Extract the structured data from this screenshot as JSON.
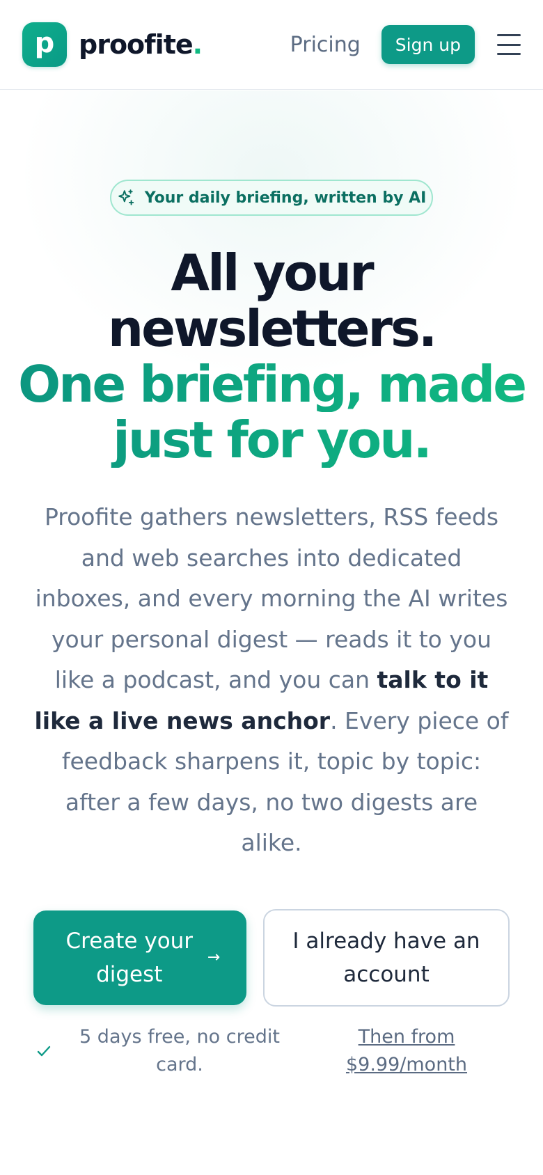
{
  "header": {
    "logo_letter": "p",
    "brand_name": "proofite",
    "brand_dot": ".",
    "nav_pricing": "Pricing",
    "signup_label": "Sign up"
  },
  "hero": {
    "badge": "Your daily briefing, written by AI",
    "headline_line1": "All your",
    "headline_line2": "newsletters.",
    "headline_accent1": "One briefing, made",
    "headline_accent2": "just for you.",
    "description_part1": "Proofite gathers newsletters, RSS feeds and web searches into dedicated inboxes, and every morning the AI writes your personal digest — reads it to you like a podcast, and you can ",
    "description_bold": "talk to it like a live news anchor",
    "description_part2": ". Every piece of feedback sharpens it, topic by topic: after a few days, no two digests are alike.",
    "cta_primary": "Create your digest",
    "cta_secondary": "I already have an account",
    "trial_note": "5 days free, no credit card.",
    "price_link": "Then from $9.99/month"
  },
  "colors": {
    "brand": "#0d9a87",
    "accent": "#10b981",
    "text_dark": "#0f172a",
    "text_muted": "#64748b"
  },
  "icons": {
    "menu": "hamburger-menu-icon",
    "badge": "sparkles-icon",
    "cta_arrow": "arrow-right-icon",
    "trial": "check-icon"
  }
}
